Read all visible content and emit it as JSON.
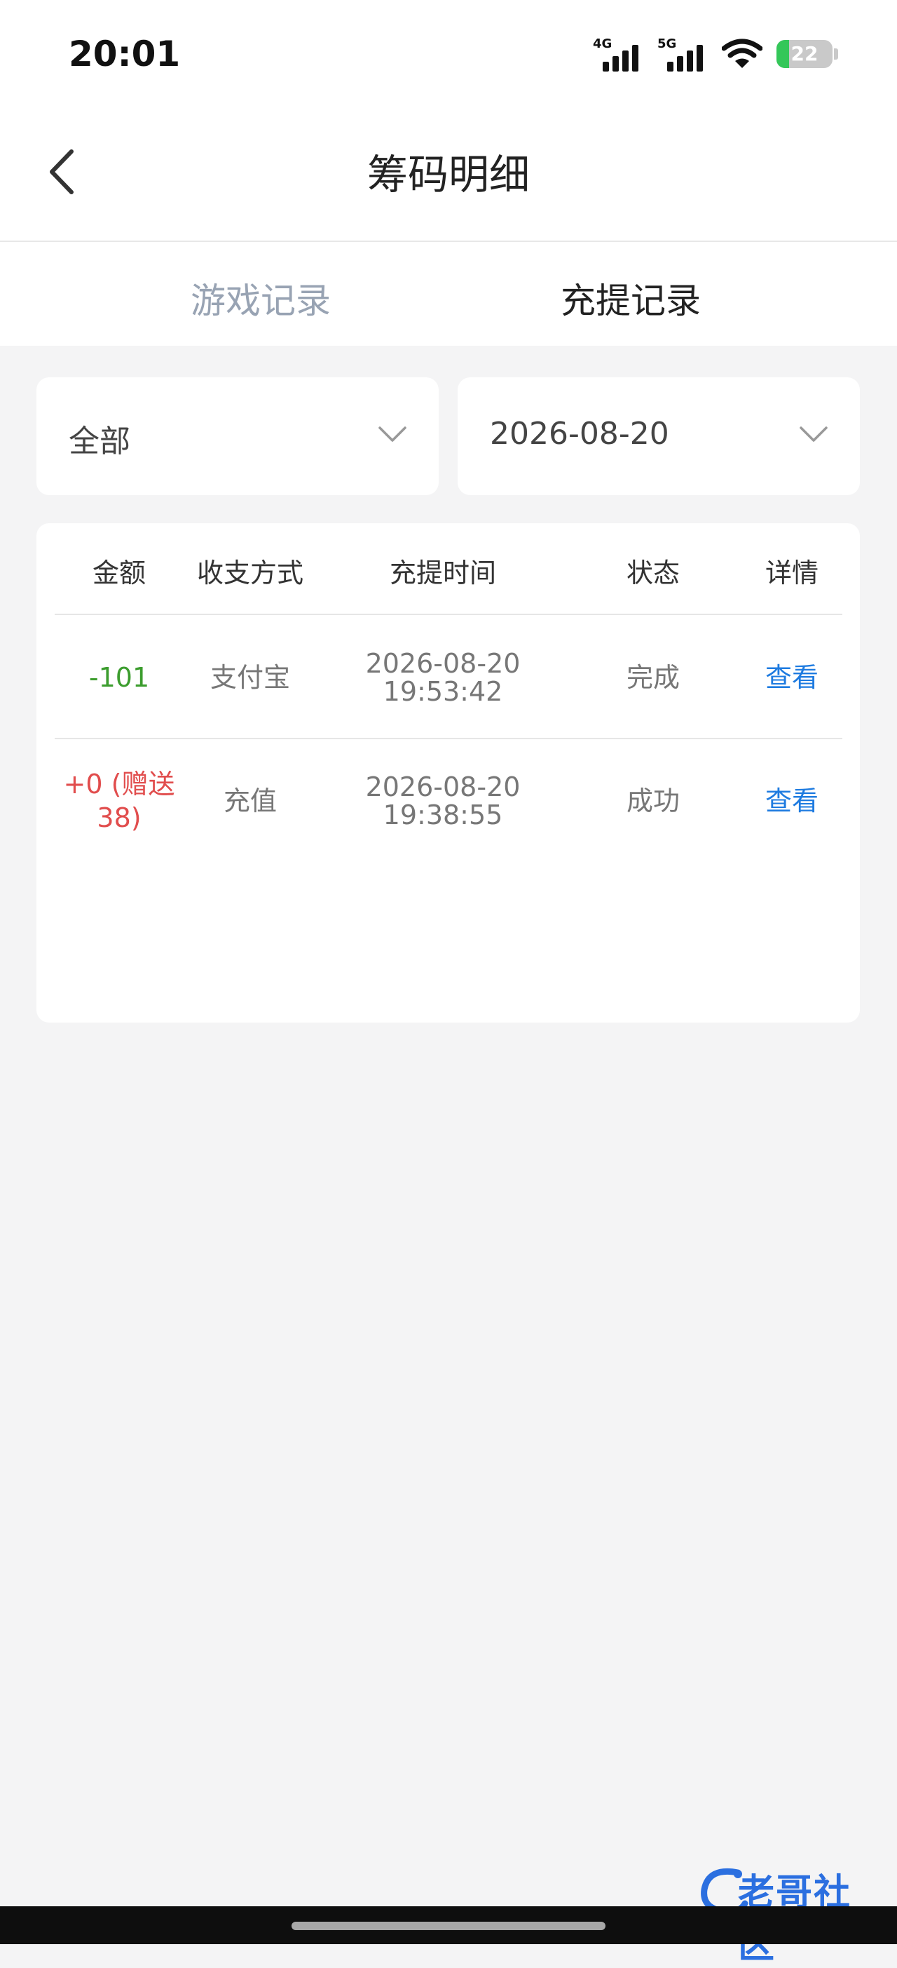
{
  "status_bar": {
    "time": "20:01",
    "signal1_label": "4G",
    "signal2_label": "5G",
    "battery": "22"
  },
  "header": {
    "title": "筹码明细"
  },
  "tabs": [
    {
      "label": "游戏记录",
      "active": false
    },
    {
      "label": "充提记录",
      "active": true
    }
  ],
  "filters": {
    "type": "全部",
    "date": "2026-08-20"
  },
  "table": {
    "columns": [
      "金额",
      "收支方式",
      "充提时间",
      "状态",
      "详情"
    ],
    "rows": [
      {
        "amount_line1": "-101",
        "amount_line2": "",
        "method": "支付宝",
        "date": "2026-08-20",
        "time": "19:53:42",
        "status": "完成",
        "action": "查看"
      },
      {
        "amount_line1": "+0 (赠送",
        "amount_line2": "38)",
        "method": "充值",
        "date": "2026-08-20",
        "time": "19:38:55",
        "status": "成功",
        "action": "查看"
      }
    ]
  },
  "watermark": {
    "text": "老哥社区"
  },
  "colors": {
    "negative": "#3c9d2e",
    "positive": "#e14d4d",
    "link": "#1e7be0",
    "tab_inactive": "#98a3b3"
  }
}
